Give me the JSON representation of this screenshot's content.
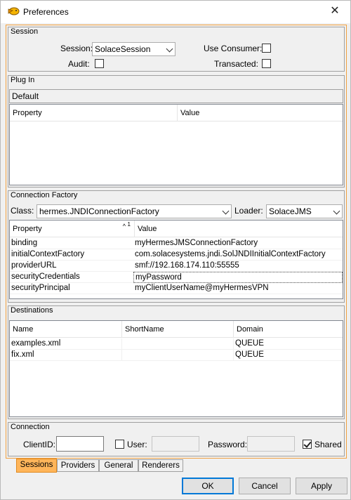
{
  "window": {
    "title": "Preferences",
    "close_glyph": "✕"
  },
  "session": {
    "title": "Session",
    "session_label": "Session:",
    "session_value": "SolaceSession",
    "use_consumer_label": "Use Consumer:",
    "audit_label": "Audit:",
    "transacted_label": "Transacted:",
    "use_consumer_checked": false,
    "audit_checked": false,
    "transacted_checked": false
  },
  "plugin": {
    "title": "Plug In",
    "selected": "Default",
    "columns": [
      "Property",
      "Value"
    ]
  },
  "connection_factory": {
    "title": "Connection Factory",
    "class_label": "Class:",
    "class_value": "hermes.JNDIConnectionFactory",
    "loader_label": "Loader:",
    "loader_value": "SolaceJMS",
    "columns": [
      "Property",
      "Value"
    ],
    "sort_indicator": "1",
    "rows": [
      {
        "property": "binding",
        "value": "myHermesJMSConnectionFactory"
      },
      {
        "property": "initialContextFactory",
        "value": "com.solacesystems.jndi.SolJNDIInitialContextFactory"
      },
      {
        "property": "providerURL",
        "value": "smf://192.168.174.110:55555"
      },
      {
        "property": "securityCredentials",
        "value": "myPassword"
      },
      {
        "property": "securityPrincipal",
        "value": "myClientUserName@myHermesVPN"
      }
    ]
  },
  "destinations": {
    "title": "Destinations",
    "columns": [
      "Name",
      "ShortName",
      "Domain"
    ],
    "rows": [
      {
        "name": "examples.xml",
        "short_name": "",
        "domain": "QUEUE"
      },
      {
        "name": "fix.xml",
        "short_name": "",
        "domain": "QUEUE"
      }
    ]
  },
  "connection": {
    "title": "Connection",
    "client_id_label": "ClientID:",
    "client_id_value": "",
    "user_label": "User:",
    "user_value": "",
    "password_label": "Password:",
    "password_value": "",
    "shared_label": "Shared",
    "user_checked": false,
    "shared_checked": true
  },
  "tabs": [
    {
      "label": "Sessions",
      "active": true
    },
    {
      "label": "Providers",
      "active": false
    },
    {
      "label": "General",
      "active": false
    },
    {
      "label": "Renderers",
      "active": false
    }
  ],
  "buttons": {
    "ok": "OK",
    "cancel": "Cancel",
    "apply": "Apply"
  },
  "colors": {
    "accent_orange": "#ffb55a",
    "focus_blue": "#0078d7"
  }
}
